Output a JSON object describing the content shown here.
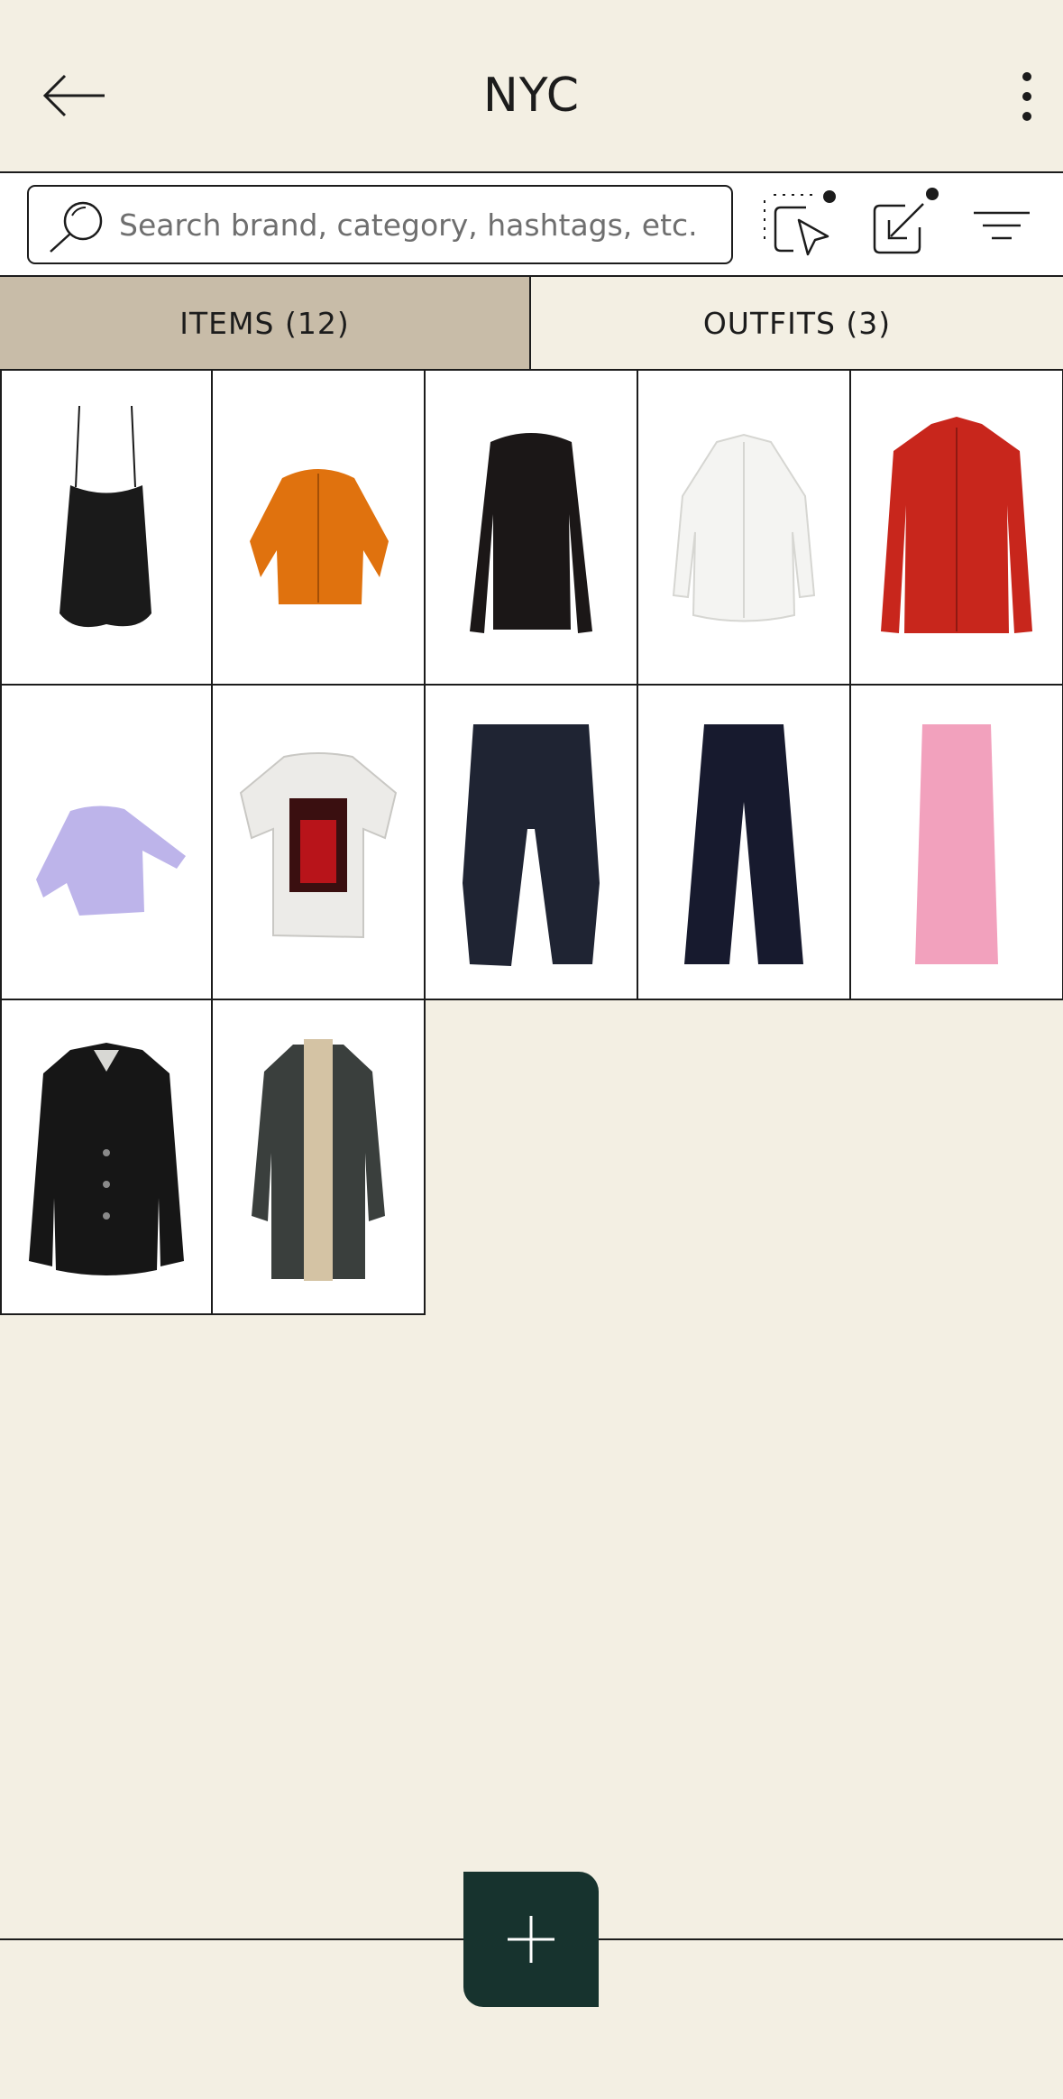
{
  "header": {
    "title": "NYC",
    "back_icon": "arrow-left-icon",
    "more_icon": "more-vertical-icon"
  },
  "toolbar": {
    "search_placeholder": "Search brand, category, hashtags, etc.",
    "search_value": "",
    "select_icon": "multi-select-icon",
    "share_icon": "export-icon",
    "filter_icon": "filter-icon"
  },
  "tabs": [
    {
      "label": "ITEMS (12)",
      "active": true
    },
    {
      "label": "OUTFITS (3)",
      "active": false
    }
  ],
  "items": [
    {
      "name": "black-camisole",
      "color": "#1a1a1a"
    },
    {
      "name": "orange-cardigan",
      "color": "#e0720e"
    },
    {
      "name": "black-long-sleeve-top",
      "color": "#1b1717"
    },
    {
      "name": "white-button-shirt",
      "color": "#f4f4f2"
    },
    {
      "name": "red-button-shirt",
      "color": "#c8261c"
    },
    {
      "name": "lavender-sweater",
      "color": "#bdb4ea"
    },
    {
      "name": "white-graphic-tee",
      "color": "#ecebe8"
    },
    {
      "name": "dark-denim-jeans",
      "color": "#1f2433"
    },
    {
      "name": "navy-wide-trousers",
      "color": "#171a2e"
    },
    {
      "name": "pink-midi-skirt",
      "color": "#f2a1bd"
    },
    {
      "name": "black-blazer",
      "color": "#161616"
    },
    {
      "name": "houndstooth-coat",
      "color": "#3a3f3d"
    }
  ],
  "fab_icon": "plus-icon",
  "colors": {
    "background": "#f3efe3",
    "active_tab": "#c8bca8",
    "fab": "#17332e"
  }
}
